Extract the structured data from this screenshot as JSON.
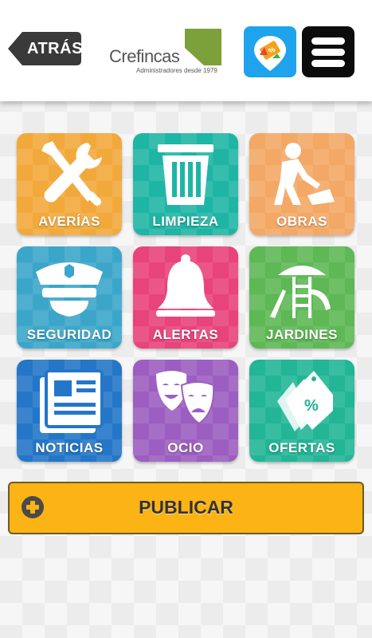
{
  "header": {
    "back_label": "ATRÁS",
    "logo_name": "Crefincas",
    "logo_tagline": "Administradores desde 1979",
    "offers_icon": "price-tag-icon",
    "menu_icon": "hamburger-menu-icon"
  },
  "tiles": [
    {
      "label": "AVERÍAS",
      "icon": "tools-icon",
      "color": "#f2a93b"
    },
    {
      "label": "LIMPIEZA",
      "icon": "trash-can-icon",
      "color": "#1fb5a5"
    },
    {
      "label": "OBRAS",
      "icon": "construction-worker-icon",
      "color": "#f3a865"
    },
    {
      "label": "SEGURIDAD",
      "icon": "police-cap-icon",
      "color": "#3ba6c9"
    },
    {
      "label": "ALERTAS",
      "icon": "bell-icon",
      "color": "#e8437b"
    },
    {
      "label": "JARDINES",
      "icon": "playground-icon",
      "color": "#5db855"
    },
    {
      "label": "NOTICIAS",
      "icon": "newspaper-icon",
      "color": "#2476c7"
    },
    {
      "label": "OCIO",
      "icon": "theater-masks-icon",
      "color": "#9c5ec0"
    },
    {
      "label": "OFERTAS",
      "icon": "discount-tags-icon",
      "color": "#22b596"
    }
  ],
  "publish": {
    "label": "PUBLICAR",
    "icon": "plus-circle-icon",
    "color": "#fbb315"
  }
}
